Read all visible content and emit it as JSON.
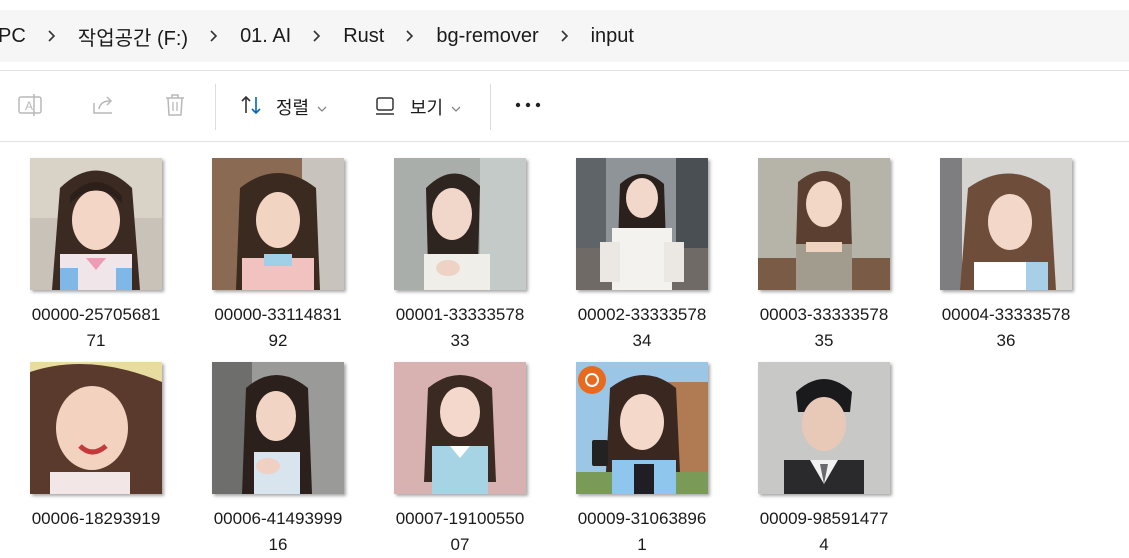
{
  "breadcrumb": {
    "items": [
      "PC",
      "작업공간 (F:)",
      "01. AI",
      "Rust",
      "bg-remover",
      "input"
    ],
    "separator_icon": "chevron-right-icon"
  },
  "toolbar": {
    "rename_icon": "rename-icon",
    "share_icon": "share-icon",
    "delete_icon": "trash-icon",
    "sort_label": "정렬",
    "view_label": "보기",
    "more_icon": "more-icon"
  },
  "files": [
    {
      "line1": "00000-25705681",
      "line2": "71"
    },
    {
      "line1": "00000-33114831",
      "line2": "92"
    },
    {
      "line1": "00001-33333578",
      "line2": "33"
    },
    {
      "line1": "00002-33333578",
      "line2": "34"
    },
    {
      "line1": "00003-33333578",
      "line2": "35"
    },
    {
      "line1": "00004-33333578",
      "line2": "36"
    },
    {
      "line1": "00006-18293919",
      "line2": ""
    },
    {
      "line1": "00006-41493999",
      "line2": "16"
    },
    {
      "line1": "00007-19100550",
      "line2": "07"
    },
    {
      "line1": "00009-31063896",
      "line2": "1"
    },
    {
      "line1": "00009-98591477",
      "line2": "4"
    }
  ],
  "colors": {
    "accent": "#0067c0",
    "icon_gray": "#b8b8b8"
  }
}
